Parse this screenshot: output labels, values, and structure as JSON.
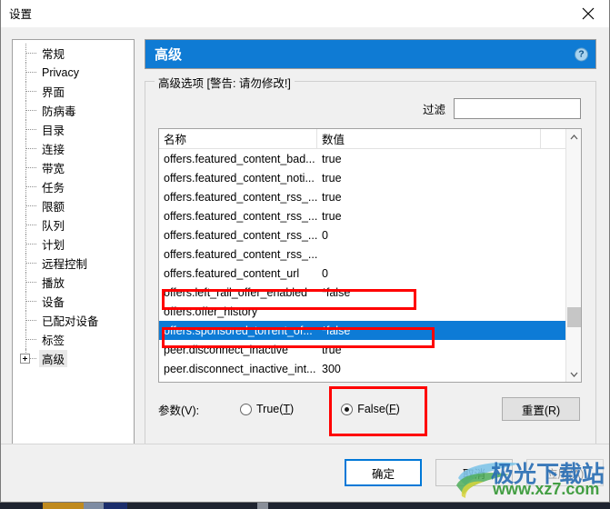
{
  "window": {
    "title": "设置",
    "close_label": "×"
  },
  "sidebar": {
    "items": [
      {
        "label": "常规"
      },
      {
        "label": "Privacy"
      },
      {
        "label": "界面"
      },
      {
        "label": "防病毒"
      },
      {
        "label": "目录"
      },
      {
        "label": "连接"
      },
      {
        "label": "带宽"
      },
      {
        "label": "任务"
      },
      {
        "label": "限额"
      },
      {
        "label": "队列"
      },
      {
        "label": "计划"
      },
      {
        "label": "远程控制"
      },
      {
        "label": "播放"
      },
      {
        "label": "设备"
      },
      {
        "label": "已配对设备"
      },
      {
        "label": "标签"
      },
      {
        "label": "高级"
      }
    ]
  },
  "pane": {
    "banner_title": "高级",
    "help_icon": "?",
    "group_legend": "高级选项 [警告: 请勿修改!]",
    "filter_label": "过滤",
    "filter_value": "",
    "filter_placeholder": ""
  },
  "list": {
    "columns": [
      "名称",
      "数值"
    ],
    "rows": [
      {
        "name": "offers.featured_content_bad...",
        "value": "true"
      },
      {
        "name": "offers.featured_content_noti...",
        "value": "true"
      },
      {
        "name": "offers.featured_content_rss_...",
        "value": "true"
      },
      {
        "name": "offers.featured_content_rss_...",
        "value": "true"
      },
      {
        "name": "offers.featured_content_rss_...",
        "value": "0"
      },
      {
        "name": "offers.featured_content_rss_...",
        "value": ""
      },
      {
        "name": "offers.featured_content_url",
        "value": "0"
      },
      {
        "name": "offers.left_rail_offer_enabled",
        "value": "*false"
      },
      {
        "name": "offers.offer_history",
        "value": ""
      },
      {
        "name": "offers.sponsored_torrent_of...",
        "value": "*false"
      },
      {
        "name": "peer.disconnect_inactive",
        "value": "true"
      },
      {
        "name": "peer.disconnect_inactive_int...",
        "value": "300"
      }
    ],
    "selected_index": 9,
    "scroll_up_icon": "⌃",
    "scroll_down_icon": "⌄"
  },
  "params": {
    "label": "参数(V):",
    "true_option": {
      "text": "True(",
      "key": "T",
      "tail": ")",
      "checked": false
    },
    "false_option": {
      "text": "False(",
      "key": "F",
      "tail": ")",
      "checked": true
    },
    "reset_label": "重置(R)"
  },
  "footer": {
    "ok": "确定",
    "cancel": "取消",
    "apply": "应用(A)"
  },
  "watermark": {
    "cn": "极光下载站",
    "url": "www.xz7.com"
  },
  "colors": {
    "banner_blue": "#0f7bd4",
    "selection_blue": "#0d7bd6",
    "annotation_red": "#ff0000",
    "focus_blue": "#0078d7"
  }
}
